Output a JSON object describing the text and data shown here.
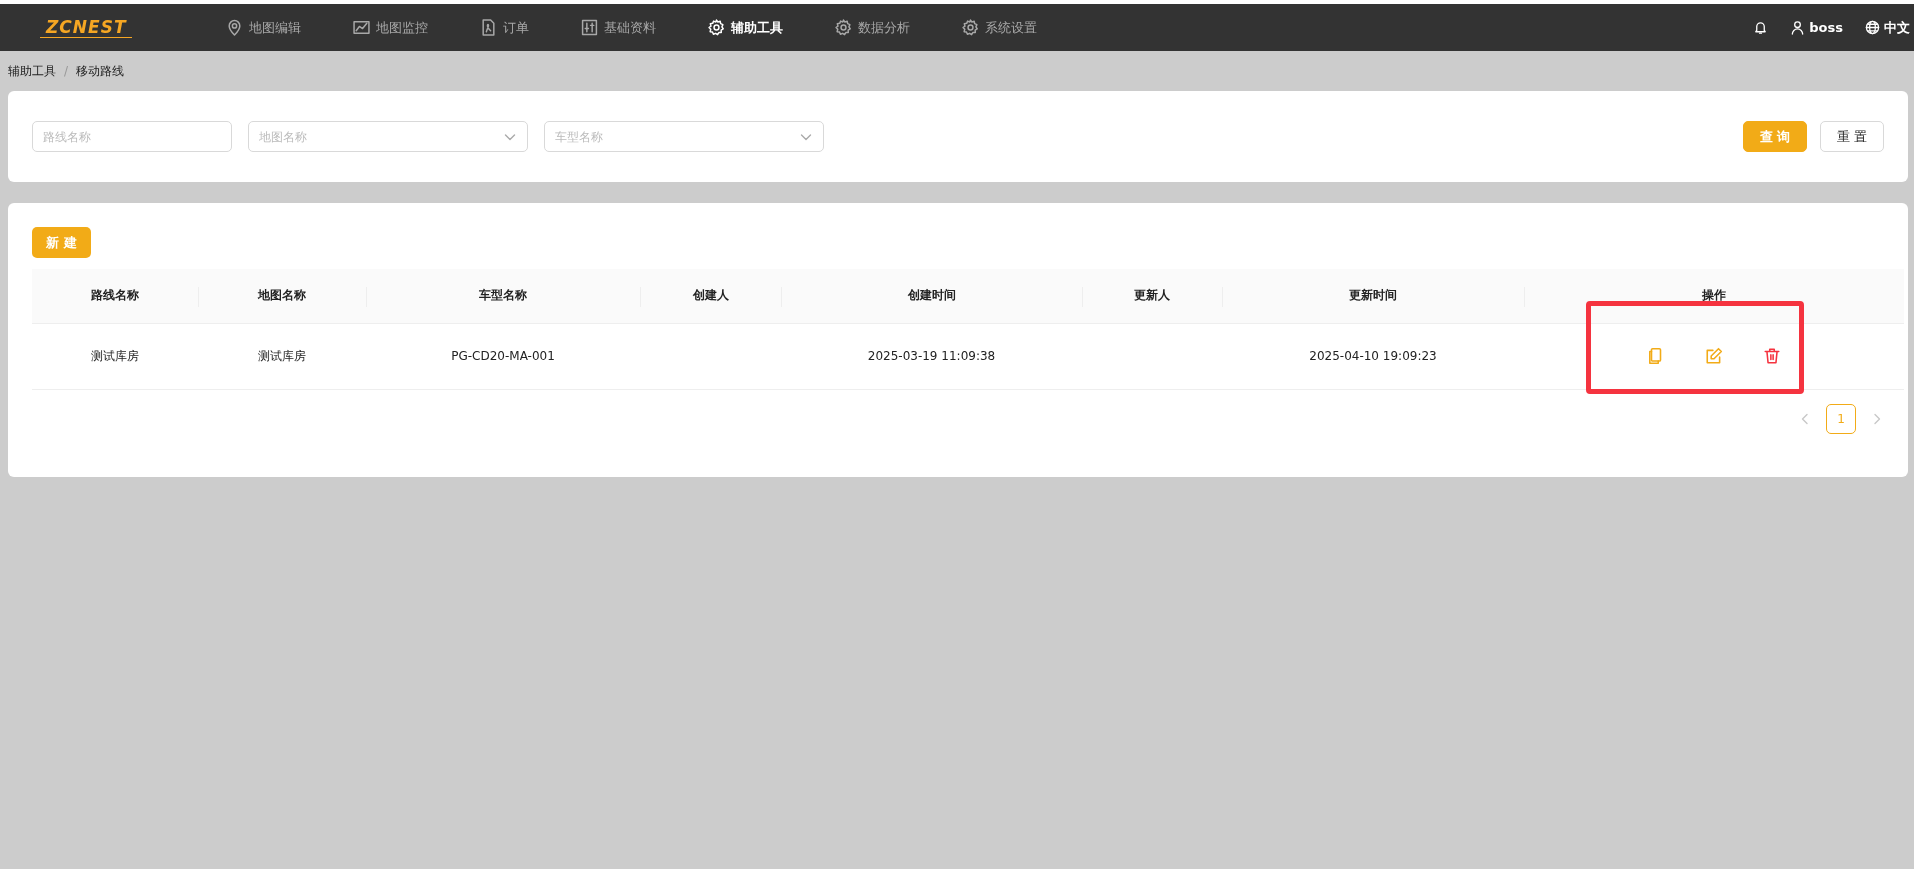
{
  "header": {
    "logo": "ZCNEST",
    "nav": [
      {
        "label": "地图编辑",
        "selected": false
      },
      {
        "label": "地图监控",
        "selected": false
      },
      {
        "label": "订单",
        "selected": false
      },
      {
        "label": "基础资料",
        "selected": false
      },
      {
        "label": "辅助工具",
        "selected": true
      },
      {
        "label": "数据分析",
        "selected": false
      },
      {
        "label": "系统设置",
        "selected": false
      }
    ],
    "user": "boss",
    "language": "中文"
  },
  "breadcrumb": {
    "items": [
      "辅助工具",
      "移动路线"
    ],
    "separator": "/"
  },
  "filters": {
    "fields": [
      {
        "kind": "input",
        "placeholder": "路线名称"
      },
      {
        "kind": "select",
        "placeholder": "地图名称"
      },
      {
        "kind": "select",
        "placeholder": "车型名称"
      }
    ],
    "buttons": [
      {
        "label": "查 询",
        "kind": "primary"
      },
      {
        "label": "重 置",
        "kind": "default"
      }
    ]
  },
  "new_button": "新 建",
  "table": {
    "columns": [
      "路线名称",
      "地图名称",
      "车型名称",
      "创建人",
      "创建时间",
      "更新人",
      "更新时间",
      "操作"
    ],
    "rows": [
      {
        "cells": [
          "测试库房",
          "测试库房",
          "PG-CD20-MA-001",
          "",
          "2025-03-19 11:09:38",
          "",
          "2025-04-10 19:09:23"
        ],
        "actions": [
          {
            "kind": "copy"
          },
          {
            "kind": "edit"
          },
          {
            "kind": "delete"
          }
        ]
      }
    ]
  },
  "pagination": {
    "prev_disabled": true,
    "next_disabled": true,
    "pages": [
      {
        "label": "1",
        "selected": true
      }
    ]
  },
  "annotation": {
    "kind": "highlight-box"
  }
}
